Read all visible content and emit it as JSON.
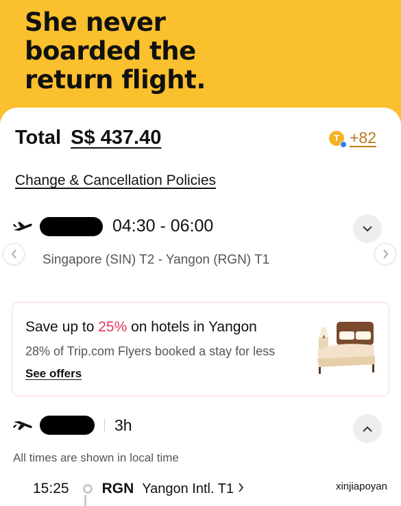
{
  "headline": {
    "line1": "She never",
    "line2": "boarded the",
    "line3": "return flight."
  },
  "booking": {
    "total_label": "Total",
    "total_amount": "S$ 437.40",
    "points_coin_glyph": "T",
    "points_value": "+82",
    "policies_link": "Change & Cancellation Policies"
  },
  "outbound": {
    "icon": "plane-takeoff-icon",
    "times": "04:30 - 06:00",
    "route": "Singapore (SIN) T2 - Yangon (RGN) T1"
  },
  "hotel_promo": {
    "title_prefix": "Save up to ",
    "title_percent": "25%",
    "title_suffix": " on hotels in Yangon",
    "subtitle": "28% of Trip.com Flyers booked a stay for less",
    "link": "See offers"
  },
  "return_flight": {
    "icon": "plane-landing-icon",
    "duration": "3h",
    "timezone_note": "All times are shown in local time",
    "segment": {
      "time": "15:25",
      "code": "RGN",
      "airport": "Yangon Intl. T1"
    }
  },
  "watermark": "xinjiapoyan",
  "colors": {
    "background": "#fbc02d",
    "accent_price": "#e8325a",
    "points": "#b87a17"
  }
}
